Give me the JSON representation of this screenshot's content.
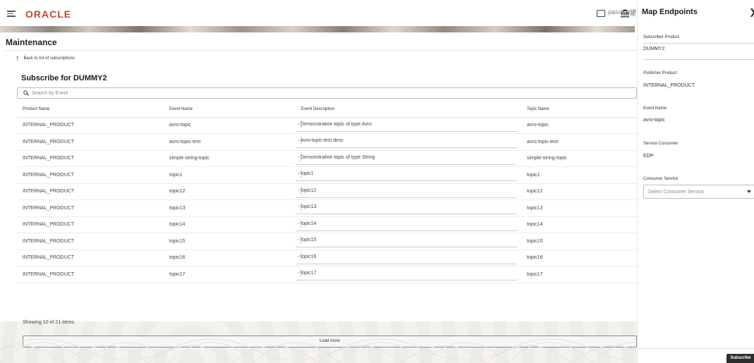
{
  "header": {
    "brand": "ORACLE",
    "entity_label": "(DEFAULTENTITY)",
    "bank_label": "OE\nHC"
  },
  "page": {
    "title": "Maintenance",
    "back_link": "Back to list of subscriptions",
    "subtitle": "Subscribe for DUMMY2"
  },
  "search": {
    "placeholder": "Search by Event"
  },
  "table": {
    "columns": [
      "Product Name",
      "Event Name",
      "Event Description",
      "Topic Name"
    ],
    "rows": [
      [
        "INTERNAL_PRODUCT",
        "avro-topic",
        "Demonstration topic of type Avro",
        "avro-topic"
      ],
      [
        "INTERNAL_PRODUCT",
        "avro-topic-test",
        "avro-topic-test desc",
        "avro-topic-test"
      ],
      [
        "INTERNAL_PRODUCT",
        "simple-string-topic",
        "Demonstration topic of type String",
        "simple-string-topic"
      ],
      [
        "INTERNAL_PRODUCT",
        "topic1",
        "topic1",
        "topic1"
      ],
      [
        "INTERNAL_PRODUCT",
        "topic12",
        "topic12",
        "topic12"
      ],
      [
        "INTERNAL_PRODUCT",
        "topic13",
        "topic13",
        "topic13"
      ],
      [
        "INTERNAL_PRODUCT",
        "topic14",
        "topic14",
        "topic14"
      ],
      [
        "INTERNAL_PRODUCT",
        "topic15",
        "topic15",
        "topic15"
      ],
      [
        "INTERNAL_PRODUCT",
        "topic16",
        "topic16",
        "topic16"
      ],
      [
        "INTERNAL_PRODUCT",
        "topic17",
        "topic17",
        "topic17"
      ]
    ],
    "showing": "Showing 10 of 21 items.",
    "load_more": "Load more"
  },
  "panel": {
    "title": "Map Endpoints",
    "subscriber_product_label": "Subscriber Product",
    "subscriber_product_value": "DUMMY2",
    "publisher_product_label": "Publisher Product",
    "publisher_product_value": "INTERNAL_PRODUCT",
    "event_name_label": "Event Name",
    "event_name_value": "avro-topic",
    "service_consumer_label": "Service Consumer",
    "service_consumer_value": "EDP",
    "consumer_service_label": "Consumer Service",
    "consumer_service_placeholder": "Select Consumer Service",
    "subscribe_label": "Subscribe"
  },
  "colors": {
    "brand": "#c74634",
    "button_dark": "#2e2e2e"
  }
}
